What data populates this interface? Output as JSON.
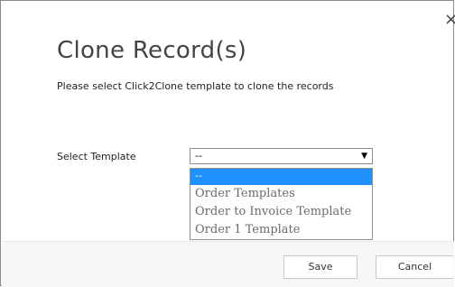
{
  "dialog": {
    "title": "Clone Record(s)",
    "subtitle": "Please select Click2Clone template to clone the records",
    "close_glyph": "×"
  },
  "form": {
    "select_label": "Select Template",
    "selected_value": "--",
    "arrow_glyph": "▼",
    "options": [
      {
        "label": "--",
        "highlighted": true
      },
      {
        "label": "Order Templates",
        "highlighted": false
      },
      {
        "label": "Order to Invoice Template",
        "highlighted": false
      },
      {
        "label": "Order 1 Template",
        "highlighted": false
      }
    ]
  },
  "buttons": {
    "save_label": "Save",
    "cancel_label": "Cancel"
  },
  "colors": {
    "highlight": "#1e90ff",
    "option_text": "#6b6b6b",
    "footer_bg": "#f7f7f7"
  }
}
